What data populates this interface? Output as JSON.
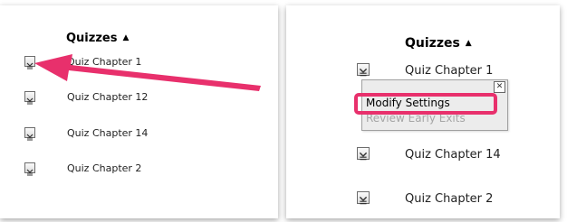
{
  "left_panel": {
    "header": "Quizzes",
    "sort_indicator": "▲",
    "quizzes": [
      "Quiz Chapter 1",
      "Quiz Chapter 12",
      "Quiz Chapter 14",
      "Quiz Chapter 2"
    ]
  },
  "right_panel": {
    "header": "Quizzes",
    "sort_indicator": "▲",
    "quizzes": [
      "Quiz Chapter 1",
      "Quiz Chapter 14",
      "Quiz Chapter 2"
    ],
    "popup": {
      "close_glyph": "✕",
      "items": [
        "Modify Settings",
        "Review Early Exits"
      ]
    }
  },
  "colors": {
    "highlight": "#e8306c",
    "popup_bg": "#ececec",
    "disabled_text": "#a6a6a6"
  },
  "icons": {
    "quiz": "quiz-icon",
    "sort": "sort-ascending-icon",
    "close": "close-icon",
    "annotation_arrow": "arrow-icon"
  }
}
